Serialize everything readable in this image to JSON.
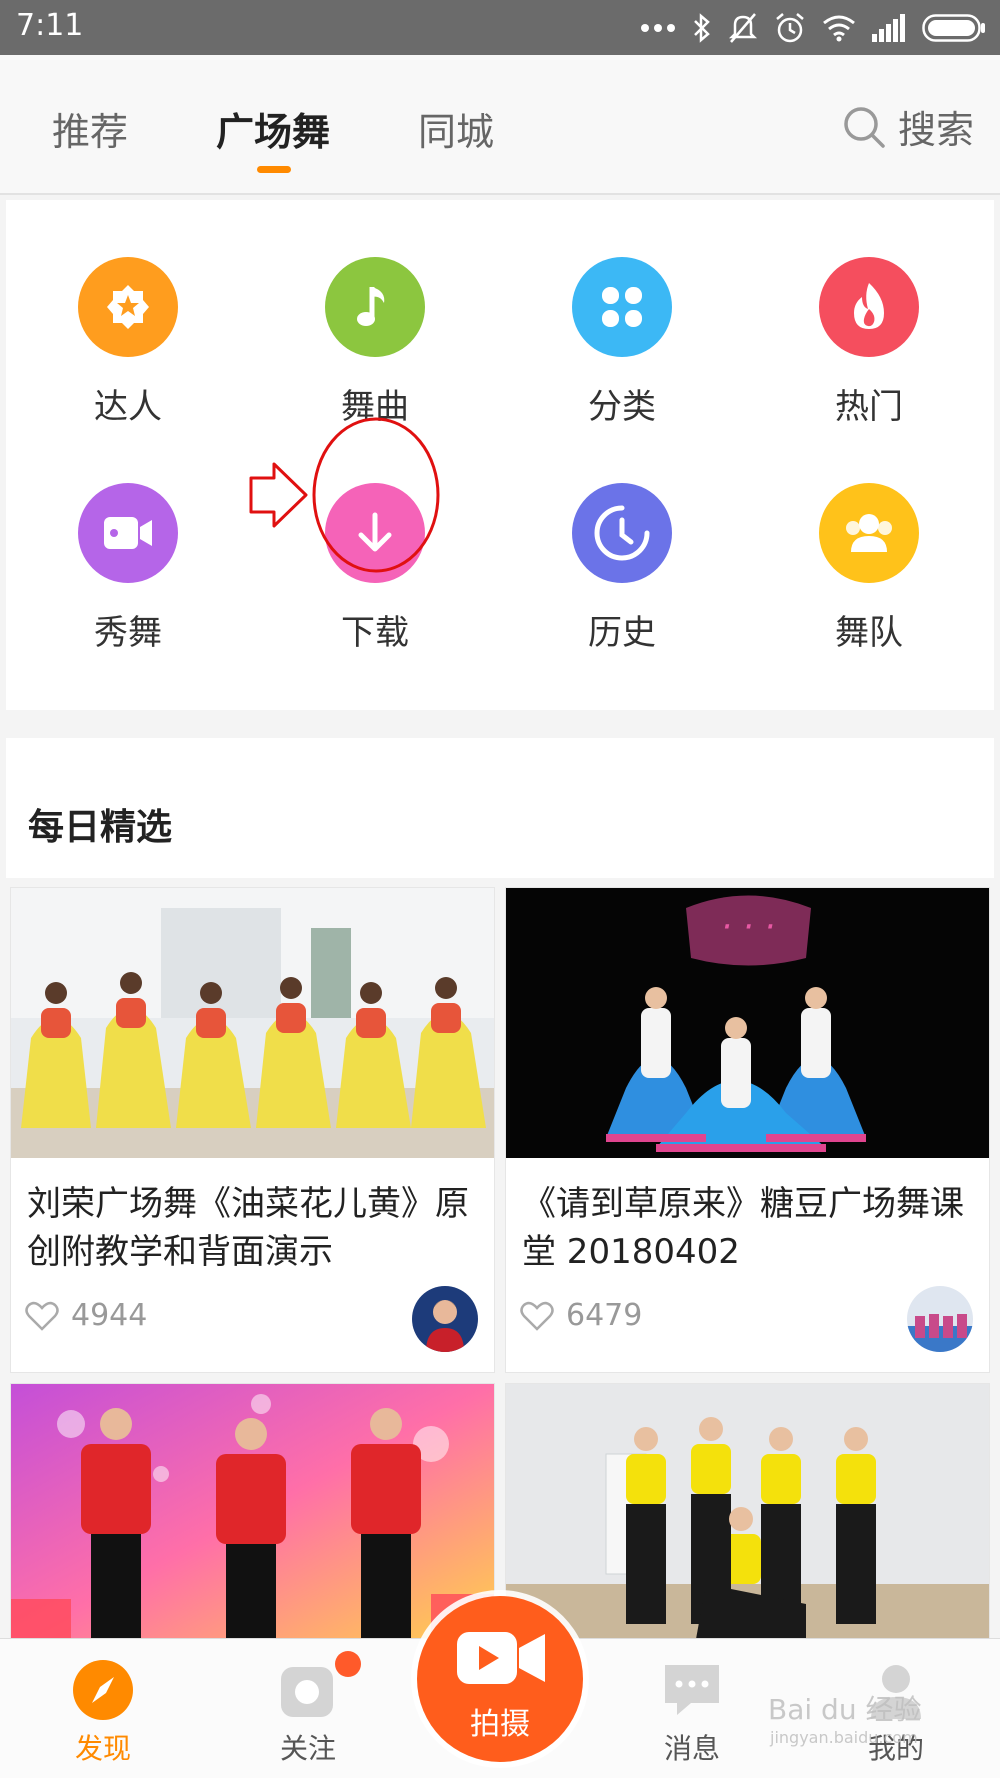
{
  "status_bar": {
    "time": "7:11"
  },
  "top_tabs": [
    {
      "label": "推荐"
    },
    {
      "label": "广场舞"
    },
    {
      "label": "同城"
    }
  ],
  "search": {
    "label": "搜索"
  },
  "grid": [
    {
      "label": "达人",
      "icon": "medal-icon",
      "color": "#ff9d1e"
    },
    {
      "label": "舞曲",
      "icon": "music-note-icon",
      "color": "#8cc63f"
    },
    {
      "label": "分类",
      "icon": "category-icon",
      "color": "#3cb8f5"
    },
    {
      "label": "热门",
      "icon": "fire-icon",
      "color": "#f54e5e"
    },
    {
      "label": "秀舞",
      "icon": "video-camera-icon",
      "color": "#b565e8"
    },
    {
      "label": "下载",
      "icon": "download-icon",
      "color": "#f563b8"
    },
    {
      "label": "历史",
      "icon": "clock-icon",
      "color": "#6b73e8"
    },
    {
      "label": "舞队",
      "icon": "group-icon",
      "color": "#ffc21a"
    }
  ],
  "section": {
    "title": "每日精选"
  },
  "videos": [
    {
      "title": "刘荣广场舞《油菜花儿黄》原创附教学和背面演示",
      "likes": "4944"
    },
    {
      "title": "《请到草原来》糖豆广场舞课堂 20180402",
      "likes": "6479"
    },
    {
      "title": "",
      "likes": ""
    },
    {
      "title": "",
      "likes": ""
    }
  ],
  "bottom_nav": {
    "discover": "发现",
    "follow": "关注",
    "shoot": "拍摄",
    "messages": "消息",
    "mine": "我的"
  },
  "watermark": {
    "main": "Bai du 经验",
    "sub": "jingyan.baidu.com"
  },
  "colors": {
    "accent": "#ff8a00",
    "shoot": "#ff5d1c",
    "annotation": "#e01010"
  }
}
